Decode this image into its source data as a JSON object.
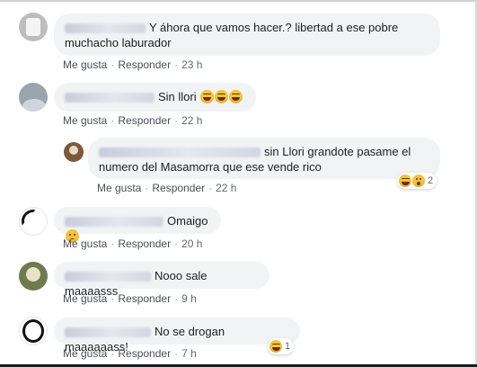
{
  "actions": {
    "like": "Me gusta",
    "reply": "Responder",
    "separator": "·"
  },
  "comments": [
    {
      "text": "Y áhora que vamos hacer.? libertad a ese pobre muchacho laburador",
      "time": "23 h"
    },
    {
      "text": "Sin llori",
      "emojis": [
        "laugh",
        "laugh",
        "laugh"
      ],
      "time": "22 h"
    },
    {
      "text": "sin Llori grandote pasame el numero del Masamorra que ese vende rico",
      "time": "22 h",
      "reaction": {
        "icons": [
          "laugh",
          "wow"
        ],
        "count": "2"
      }
    },
    {
      "text": "Omaigo",
      "emojis": [
        "sad"
      ],
      "time": "20 h"
    },
    {
      "text": "Nooo sale maaaasss",
      "time": "9 h"
    },
    {
      "text": "No se drogan maaaaaass!",
      "time": "7 h",
      "reaction": {
        "icons": [
          "laugh"
        ],
        "count": "1"
      }
    }
  ],
  "colors": {
    "bubble": "#f2f3f5",
    "text": "#1c1e21",
    "meta": "#606770",
    "reaction_badge": "#ffffff"
  }
}
